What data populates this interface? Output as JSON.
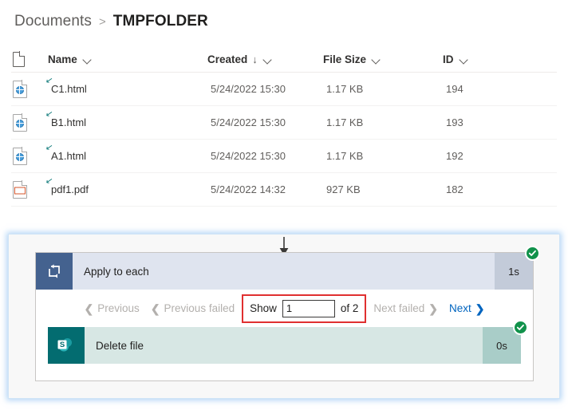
{
  "breadcrumb": {
    "root": "Documents",
    "separator": ">",
    "current": "TMPFOLDER"
  },
  "filelist": {
    "columns": {
      "icon": "",
      "name": "Name",
      "created": "Created",
      "size": "File Size",
      "id": "ID"
    },
    "sort_indicator": "↓",
    "chevron_icon": "chevron-down-icon",
    "rows": [
      {
        "icon": "html-file-icon",
        "name": "C1.html",
        "created": "5/24/2022 15:30",
        "size": "1.17 KB",
        "id": "194"
      },
      {
        "icon": "html-file-icon",
        "name": "B1.html",
        "created": "5/24/2022 15:30",
        "size": "1.17 KB",
        "id": "193"
      },
      {
        "icon": "html-file-icon",
        "name": "A1.html",
        "created": "5/24/2022 15:30",
        "size": "1.17 KB",
        "id": "192"
      },
      {
        "icon": "pdf-file-icon",
        "name": "pdf1.pdf",
        "created": "5/24/2022 14:32",
        "size": "927 KB",
        "id": "182"
      }
    ]
  },
  "flow": {
    "loop_step": {
      "icon": "loop-icon",
      "title": "Apply to each",
      "duration": "1s",
      "status": "succeeded",
      "status_icon": "checkmark-circle-icon"
    },
    "pager": {
      "previous": "Previous",
      "previous_failed": "Previous failed",
      "show_label": "Show",
      "show_value": "1",
      "of_label": "of 2",
      "next_failed": "Next failed",
      "next": "Next",
      "left_caret": "❮",
      "right_caret": "❯"
    },
    "action_step": {
      "icon": "sharepoint-icon",
      "title": "Delete file",
      "duration": "0s",
      "status": "succeeded",
      "status_icon": "checkmark-circle-icon"
    },
    "colors": {
      "loop_icon_bg": "#44628f",
      "loop_bar_bg": "#dfe4ef",
      "action_icon_bg": "#036c70",
      "action_bar_bg": "#d7e7e4",
      "success_green": "#11924b",
      "link_blue": "#0064bf",
      "highlight_red": "#e03030",
      "panel_glow": "#76b2ee"
    }
  }
}
